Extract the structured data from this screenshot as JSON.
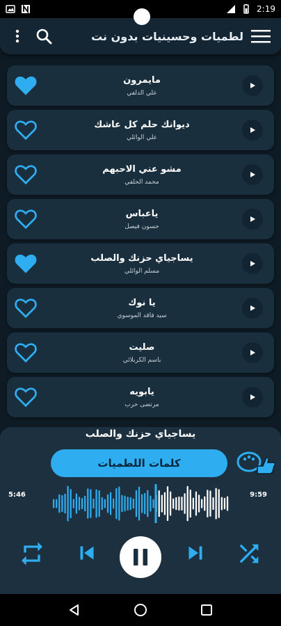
{
  "status_bar": {
    "time": "2:19",
    "left_icons": [
      "image-icon",
      "n-icon"
    ],
    "right_icons": [
      "signal-icon",
      "battery-icon"
    ]
  },
  "app_bar": {
    "title": "لطميات وحسينيات بدون نت",
    "icons": [
      "more-vert-icon",
      "search-icon",
      "hamburger-icon"
    ]
  },
  "songs": [
    {
      "title": "مايمرون",
      "artist": "علي الدلفي",
      "favorite": true
    },
    {
      "title": "ديوانك حلم كل عاشك",
      "artist": "علي الوائلي",
      "favorite": false
    },
    {
      "title": "مشو عني الاحبهم",
      "artist": "محمد الحلفي",
      "favorite": false
    },
    {
      "title": "ياعباس",
      "artist": "حسون فيصل",
      "favorite": false
    },
    {
      "title": "يساجياي حزنك والصلب",
      "artist": "مسلم الوائلي",
      "favorite": true
    },
    {
      "title": "يا نوك",
      "artist": "سيد فاقد الموسوي",
      "favorite": false
    },
    {
      "title": "صليت",
      "artist": "باسم الكربلائي",
      "favorite": false
    },
    {
      "title": "يابويه",
      "artist": "مرتضى حرب",
      "favorite": false
    }
  ],
  "player": {
    "now_playing": "يساجياي حزنك والصلب",
    "lyrics_button": "كلمات اللطميات",
    "elapsed": "5:46",
    "duration": "9:59",
    "progress": 0.58
  },
  "colors": {
    "accent": "#2eaef0",
    "background": "#0e1b25",
    "card": "#1a2f3e"
  }
}
